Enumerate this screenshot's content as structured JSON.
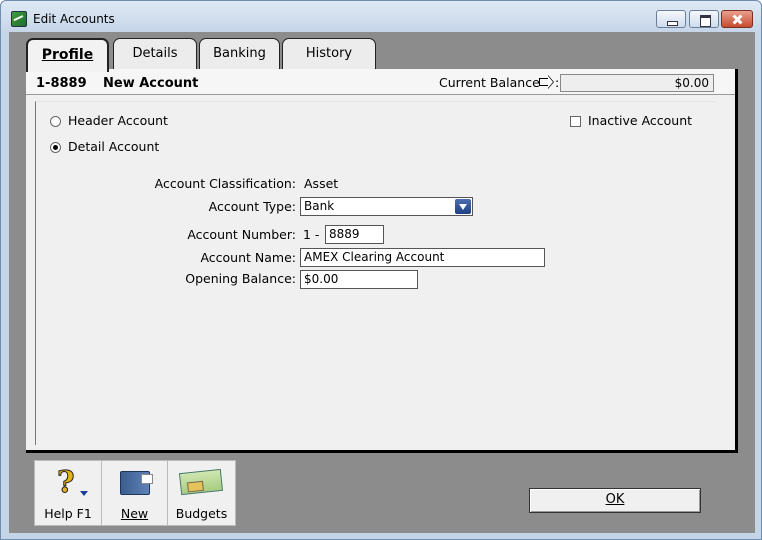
{
  "window": {
    "title": "Edit Accounts"
  },
  "tabs": [
    {
      "label": "Profile",
      "active": true
    },
    {
      "label": "Details",
      "active": false
    },
    {
      "label": "Banking",
      "active": false
    },
    {
      "label": "History",
      "active": false
    }
  ],
  "header": {
    "account_number": "1-8889",
    "account_title": "New Account",
    "current_balance_label": "Current Balance",
    "current_balance_colon": ":",
    "current_balance_value": "$0.00"
  },
  "account_level": {
    "header_label": "Header Account",
    "detail_label": "Detail Account",
    "selected": "detail"
  },
  "inactive": {
    "label": "Inactive Account",
    "checked": false
  },
  "form": {
    "classification_label": "Account Classification:",
    "classification_value": "Asset",
    "type_label": "Account Type:",
    "type_value": "Bank",
    "number_label": "Account Number:",
    "number_prefix": "1 -",
    "number_value": "8889",
    "name_label": "Account Name:",
    "name_value": "AMEX Clearing Account",
    "opening_label": "Opening Balance:",
    "opening_value": "$0.00"
  },
  "toolbar": {
    "help_label": "Help F1",
    "new_label": "New",
    "budgets_label": "Budgets"
  },
  "ok_label": "OK",
  "icons": {
    "app": "app-icon",
    "minimize": "minimize-icon",
    "maximize": "maximize-icon",
    "close": "close-icon",
    "help": "help-icon",
    "new": "new-icon",
    "budgets": "budget-icon",
    "arrow": "arrow-right-icon"
  }
}
